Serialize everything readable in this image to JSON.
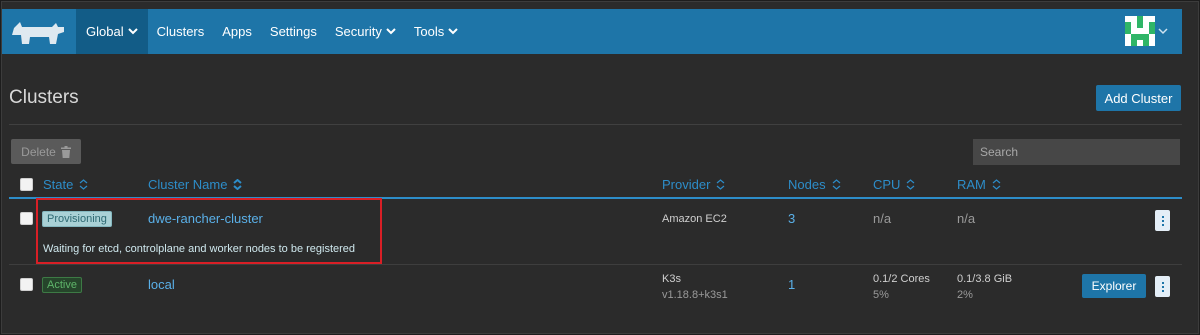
{
  "header": {
    "nav": [
      {
        "label": "Global",
        "dropdown": true,
        "active": true
      },
      {
        "label": "Clusters",
        "dropdown": false
      },
      {
        "label": "Apps",
        "dropdown": false
      },
      {
        "label": "Settings",
        "dropdown": false
      },
      {
        "label": "Security",
        "dropdown": true
      },
      {
        "label": "Tools",
        "dropdown": true
      }
    ],
    "logo_icon": "rancher-cow-logo",
    "avatar_icon": "user-avatar"
  },
  "page": {
    "title": "Clusters",
    "add_button": "Add Cluster",
    "delete_button": "Delete",
    "search_placeholder": "Search"
  },
  "table": {
    "columns": [
      "State",
      "Cluster Name",
      "Provider",
      "Nodes",
      "CPU",
      "RAM"
    ],
    "rows": [
      {
        "state": "Provisioning",
        "name": "dwe-rancher-cluster",
        "provider": "Amazon EC2",
        "provider_sub": "",
        "nodes": "3",
        "cpu": "n/a",
        "cpu_sub": "",
        "ram": "n/a",
        "ram_sub": "",
        "message": "Waiting for etcd, controlplane and worker nodes to be registered"
      },
      {
        "state": "Active",
        "name": "local",
        "provider": "K3s",
        "provider_sub": "v1.18.8+k3s1",
        "nodes": "1",
        "cpu": "0.1/2 Cores",
        "cpu_sub": "5%",
        "ram": "0.1/3.8 GiB",
        "ram_sub": "2%",
        "action": "Explorer"
      }
    ]
  },
  "colors": {
    "brand": "#1e75a8",
    "link": "#5ab0e8",
    "highlight": "#d91f26"
  }
}
